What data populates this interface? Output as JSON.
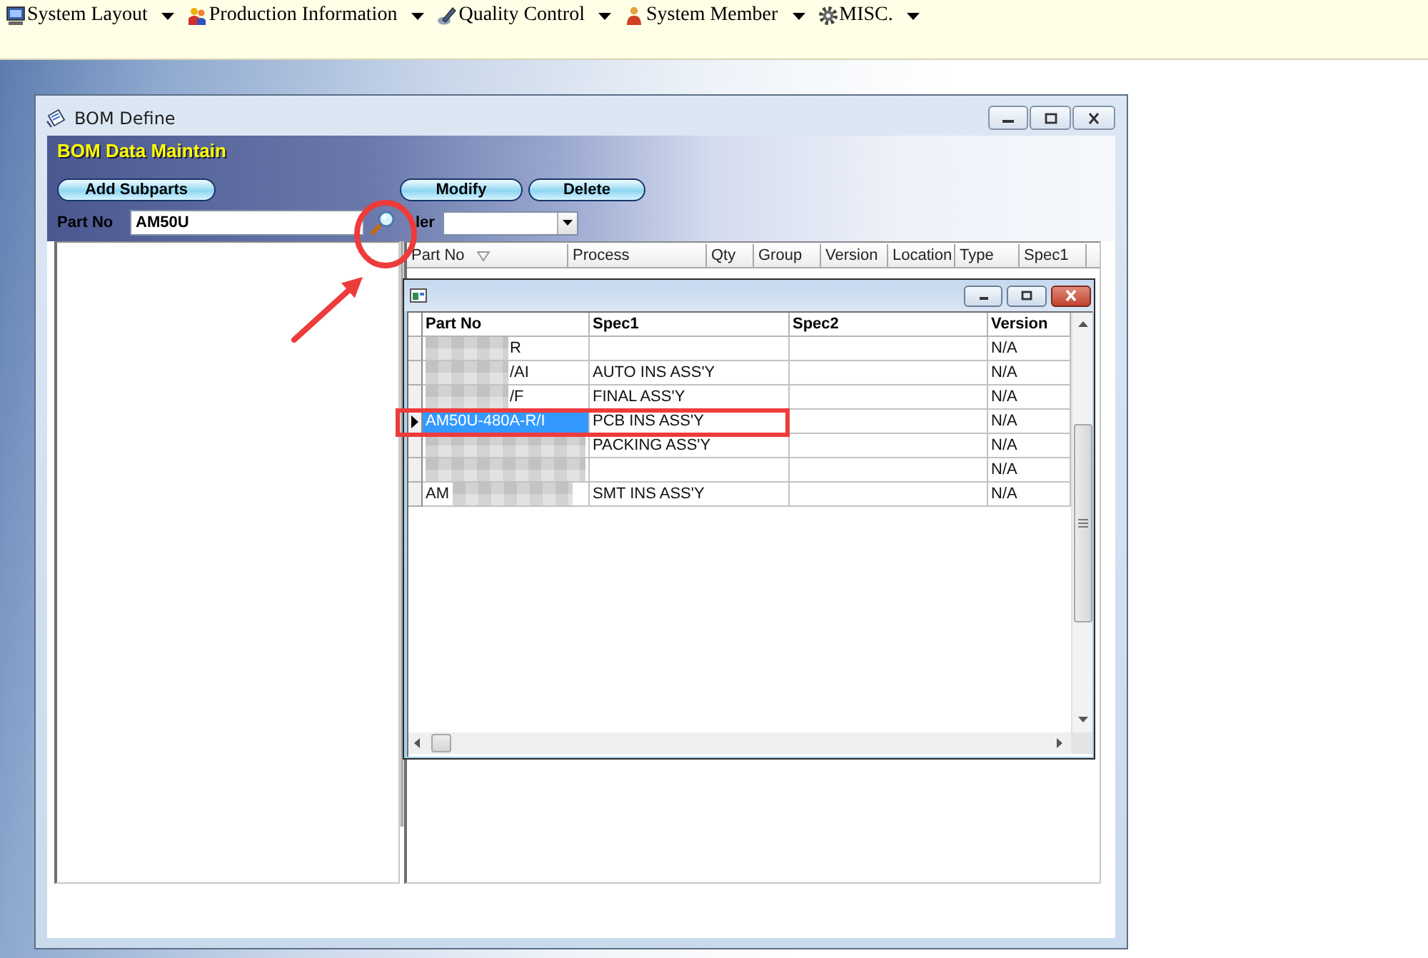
{
  "menu": [
    {
      "label": "System Layout"
    },
    {
      "label": "Production Information"
    },
    {
      "label": "Quality Control"
    },
    {
      "label": "System Member"
    },
    {
      "label": "MISC."
    }
  ],
  "window": {
    "title": "BOM Define"
  },
  "header": {
    "title": "BOM Data Maintain"
  },
  "buttons": [
    {
      "label": "Add Subparts"
    },
    {
      "label": "Modify"
    },
    {
      "label": "Delete"
    }
  ],
  "part_no": {
    "label": "Part No",
    "value": "AM50U",
    "search_highlighted": true
  },
  "filter": {
    "label": "ler"
  },
  "bom_grid": {
    "columns": [
      {
        "label": "Part No",
        "sorted": true
      },
      {
        "label": "Process",
        "sorted": false
      },
      {
        "label": "Qty",
        "sorted": false
      },
      {
        "label": "Group",
        "sorted": false
      },
      {
        "label": "Version",
        "sorted": false
      },
      {
        "label": "Location",
        "sorted": false
      },
      {
        "label": "Type",
        "sorted": false
      },
      {
        "label": "Spec1",
        "sorted": false
      }
    ]
  },
  "popup": {
    "columns": [
      "Part No",
      "Spec1",
      "Spec2",
      "Version"
    ],
    "rows": [
      {
        "part_no": "R",
        "blur_before": true,
        "blur_after": false,
        "version": "N/A",
        "selected": false,
        "highlighted": false
      },
      {
        "part_no": "/AI",
        "blur_before": true,
        "blur_after": false,
        "spec1": "AUTO INS ASS'Y",
        "version": "N/A",
        "selected": false,
        "highlighted": false
      },
      {
        "part_no": "/F",
        "blur_before": true,
        "blur_after": false,
        "spec1": "FINAL ASS'Y",
        "version": "N/A",
        "selected": false,
        "highlighted": false
      },
      {
        "part_no": "AM50U-480A-R/I",
        "blur_before": false,
        "blur_after": false,
        "spec1": "PCB INS ASS'Y",
        "version": "N/A",
        "selected": true,
        "highlighted": true
      },
      {
        "blur_before": true,
        "blur_after": false,
        "spec1": "PACKING ASS'Y",
        "version": "N/A",
        "selected": false,
        "highlighted": false
      },
      {
        "blur_before": true,
        "blur_after": false,
        "version": "N/A",
        "selected": false,
        "highlighted": false
      },
      {
        "part_no": "AM",
        "blur_before": false,
        "blur_after": true,
        "spec1": "SMT INS ASS'Y",
        "version": "N/A",
        "selected": false,
        "highlighted": false
      }
    ]
  }
}
